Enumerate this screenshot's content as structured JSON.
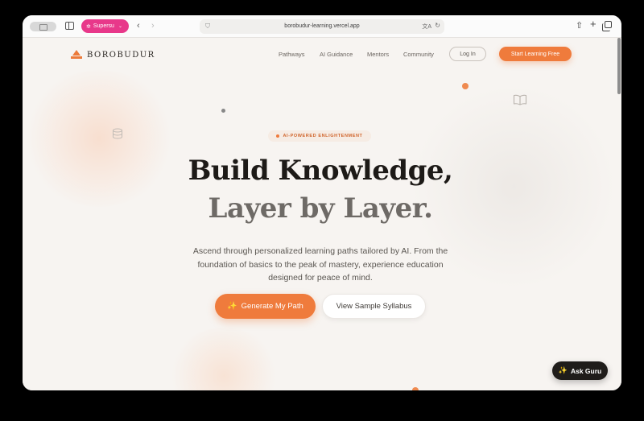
{
  "browser": {
    "profile_label": "Supersu",
    "url": "borobudur-learning.vercel.app",
    "icons": {
      "tab_overview": "tab-overview-icon",
      "sidebar": "sidebar-icon",
      "profile": "gear-icon",
      "back": "chevron-left-icon",
      "forward": "chevron-right-icon",
      "site_settings": "shield-icon",
      "translate": "translate-icon",
      "reload": "reload-icon",
      "share": "share-icon",
      "new_tab": "plus-icon",
      "tabs": "tabs-icon"
    },
    "glyphs": {
      "profile": "✲",
      "chevron": "⌄",
      "back": "‹",
      "forward": "›",
      "shield": "⛉",
      "translate": "文A",
      "reload": "↻",
      "share": "⇧",
      "plus": "+"
    }
  },
  "site": {
    "brand_name": "BOROBUDUR",
    "nav": [
      {
        "label": "Pathways"
      },
      {
        "label": "AI Guidance"
      },
      {
        "label": "Mentors"
      },
      {
        "label": "Community"
      }
    ],
    "login_label": "Log In",
    "cta_label": "Start Learning Free",
    "accent_color": "#ef7b3c",
    "dark_color": "#1f1c1a"
  },
  "hero": {
    "badge": "AI-POWERED ENLIGHTENMENT",
    "title_line1": "Build Knowledge,",
    "title_line2": "Layer by Layer.",
    "subtitle": "Ascend through personalized learning paths tailored by AI. From the foundation of basics to the peak of mastery, experience education designed for peace of mind.",
    "primary_button": "Generate My Path",
    "secondary_button": "View Sample Syllabus",
    "sparkle_glyph": "✨"
  },
  "chat_widget": {
    "label": "Ask Guru"
  },
  "decor": {
    "star_glyph": "☆"
  }
}
